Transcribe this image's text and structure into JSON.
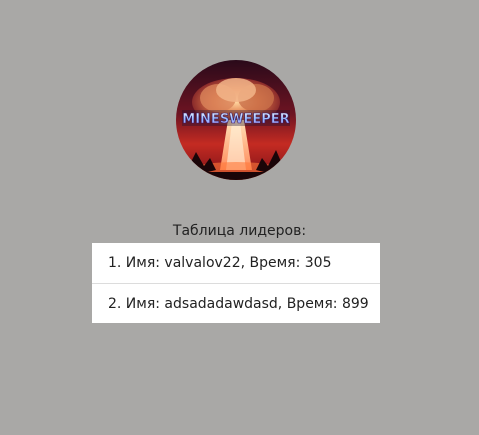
{
  "logo": {
    "text": "MINESWEEPER",
    "icon": "nuclear-explosion-logo"
  },
  "leaderboard": {
    "title": "Таблица лидеров:",
    "rows": [
      {
        "text": "1. Имя: valvalov22, Время: 305"
      },
      {
        "text": "2. Имя: adsadadawdasd, Время: 899"
      }
    ]
  },
  "colors": {
    "background": "#a9a8a6",
    "list_background": "#ffffff",
    "text": "#222222"
  }
}
